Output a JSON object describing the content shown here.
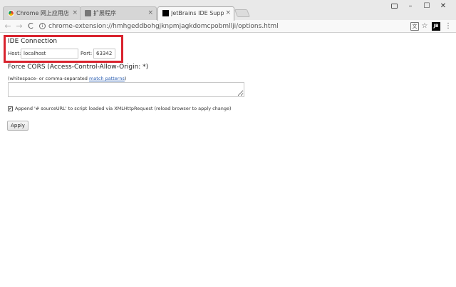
{
  "browser": {
    "tabs": [
      {
        "title": "Chrome 网上应用店 - J",
        "icon": "chrome-store-icon",
        "close": "×"
      },
      {
        "title": "扩展程序",
        "icon": "puzzle-icon",
        "close": "×"
      },
      {
        "title": "JetBrains IDE Support O",
        "icon": "jetbrains-icon",
        "close": "×"
      }
    ],
    "window_controls": {
      "user": "",
      "minimize": "–",
      "maximize": "☐",
      "close": "✕"
    },
    "nav": {
      "back": "←",
      "forward": "→",
      "reload": "C"
    },
    "address_bar": {
      "url": "chrome-extension://hmhgeddbohgjknpmjagkdomcpobmllji/options.html",
      "info_icon": "i"
    },
    "toolbar_icons": {
      "translate": "文",
      "bookmark": "☆",
      "extension": "JB",
      "menu": "⋮"
    }
  },
  "page": {
    "ide_connection": {
      "title": "IDE Connection",
      "host_label": "Host:",
      "host_value": "localhost",
      "port_label": "Port:",
      "port_value": "63342"
    },
    "cors": {
      "title": "Force CORS (Access-Control-Allow-Origin: *)",
      "hint_prefix": "(whitespace- or comma-separated ",
      "hint_link": "match patterns",
      "hint_suffix": ")",
      "value": ""
    },
    "append_source": {
      "checked": true,
      "check_mark": "✔",
      "label": "Append '# sourceURL' to script loaded via XMLHttpRequest (reload browser to apply change)"
    },
    "apply_label": "Apply"
  },
  "colors": {
    "highlight": "#d9232e",
    "link": "#2a5db0"
  }
}
